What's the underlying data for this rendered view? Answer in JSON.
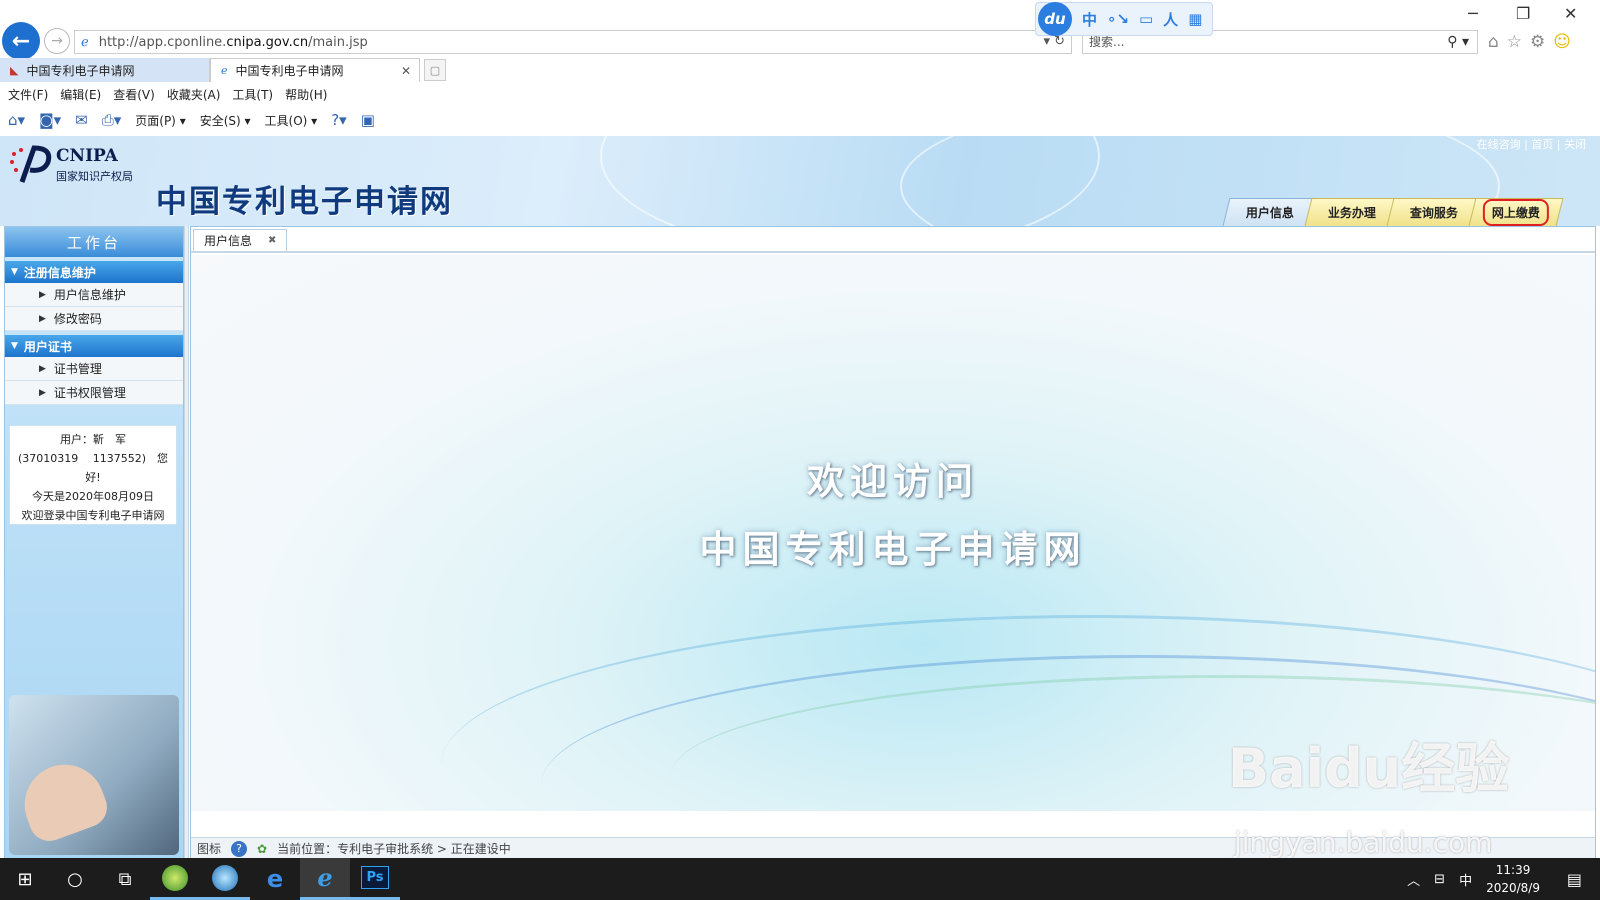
{
  "browser": {
    "url_prefix": "http://app.cponline.",
    "url_host": "cnipa.gov.cn",
    "url_path": "/main.jsp",
    "search_placeholder": "搜索...",
    "toolbar_ext": {
      "logo": "du",
      "items": [
        "中",
        "∘↘",
        "▭",
        "人",
        "▦"
      ]
    },
    "tabs": [
      {
        "label": "中国专利电子申请网",
        "active": false
      },
      {
        "label": "中国专利电子申请网",
        "active": true
      }
    ],
    "menu": [
      "文件(F)",
      "编辑(E)",
      "查看(V)",
      "收藏夹(A)",
      "工具(T)",
      "帮助(H)"
    ],
    "commands": {
      "page": "页面(P)",
      "safety": "安全(S)",
      "tools": "工具(O)"
    }
  },
  "site": {
    "logo_en": "CNIPA",
    "logo_cn": "国家知识产权局",
    "title": "中国专利电子申请网",
    "top_links": "在线咨询 | 首页 | 关闭",
    "nav_tabs": [
      "用户信息",
      "业务办理",
      "查询服务",
      "网上缴费"
    ],
    "sidebar": {
      "header": "工作台",
      "groups": [
        {
          "label": "注册信息维护",
          "items": [
            "用户信息维护",
            "修改密码"
          ]
        },
        {
          "label": "用户证书",
          "items": [
            "证书管理",
            "证书权限管理"
          ]
        }
      ]
    },
    "user_box": {
      "line1": "用户：靳　军",
      "line2a": "(37010319　 1137552)",
      "line2b": "您",
      "line3": "好!",
      "line4": "今天是2020年08月09日",
      "line5": "欢迎登录中国专利电子申请网"
    },
    "main_tab": "用户信息",
    "welcome_line1": "欢迎访问",
    "welcome_line2": "中国专利电子申请网",
    "status": {
      "label": "图标",
      "help": "?",
      "location": "当前位置：专利电子审批系统 > 正在建设中"
    }
  },
  "watermark": {
    "line1": "Baidu经验",
    "line2": "jingyan.baidu.com"
  },
  "taskbar": {
    "lang": "中",
    "time": "11:39",
    "date": "2020/8/9"
  }
}
